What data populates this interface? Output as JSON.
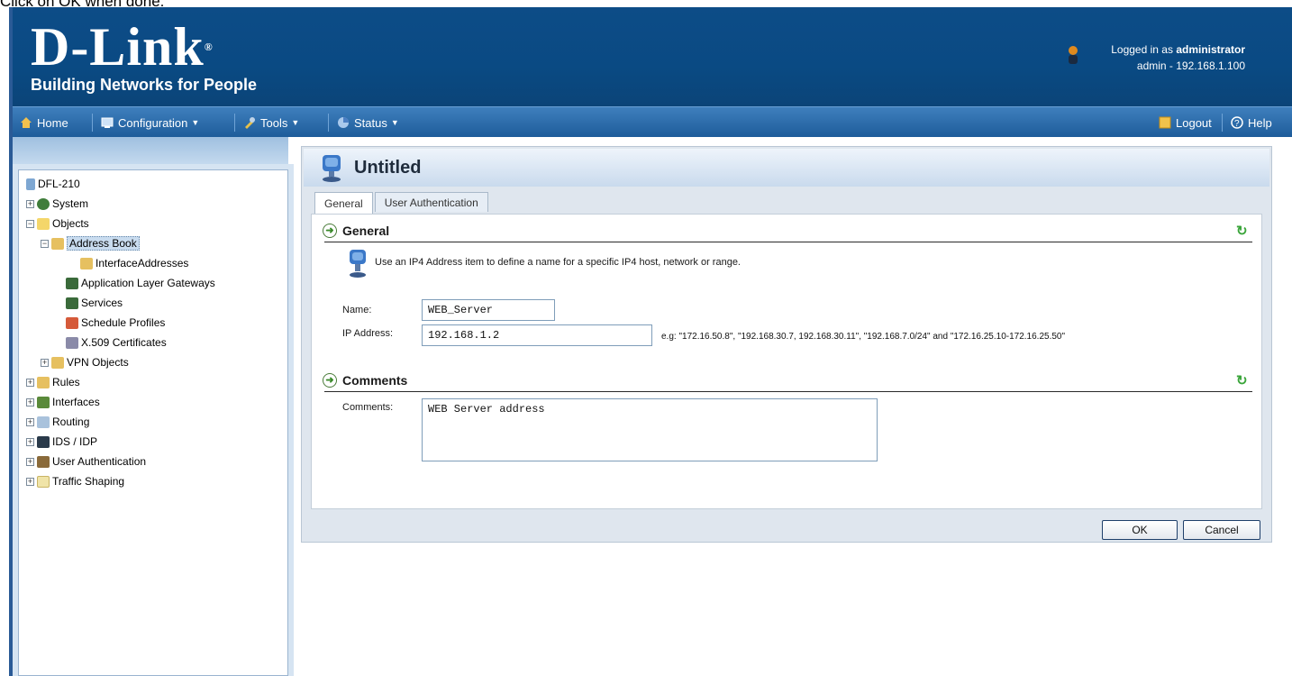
{
  "caption": "Click on OK when done.",
  "header": {
    "logo_text": "D-Link",
    "logo_tagline": "Building Networks for People",
    "logged_in_prefix": "Logged in as",
    "user": "administrator",
    "session": "admin - 192.168.1.100"
  },
  "menu": {
    "home": "Home",
    "configuration": "Configuration",
    "tools": "Tools",
    "status": "Status",
    "logout": "Logout",
    "help": "Help"
  },
  "tree": [
    {
      "label": "DFL-210"
    },
    {
      "label": "System"
    },
    {
      "label": "Objects"
    },
    {
      "label": "Address Book"
    },
    {
      "label": "InterfaceAddresses"
    },
    {
      "label": "Application Layer Gateways"
    },
    {
      "label": "Services"
    },
    {
      "label": "Schedule Profiles"
    },
    {
      "label": "X.509 Certificates"
    },
    {
      "label": "VPN Objects"
    },
    {
      "label": "Rules"
    },
    {
      "label": "Interfaces"
    },
    {
      "label": "Routing"
    },
    {
      "label": "IDS / IDP"
    },
    {
      "label": "User Authentication"
    },
    {
      "label": "Traffic Shaping"
    }
  ],
  "panel": {
    "title": "Untitled",
    "tabs": [
      {
        "label": "General"
      },
      {
        "label": "User Authentication"
      }
    ],
    "general_title": "General",
    "description": "Use an IP4 Address item to define a name for a specific IP4 host, network or range.",
    "name_label": "Name:",
    "name_value": "WEB_Server",
    "ip_label": "IP Address:",
    "ip_value": "192.168.1.2",
    "ip_hint": "e.g: \"172.16.50.8\", \"192.168.30.7, 192.168.30.11\", \"192.168.7.0/24\" and \"172.16.25.10-172.16.25.50\"",
    "comments_title": "Comments",
    "comments_label": "Comments:",
    "comments_value": "WEB Server address",
    "ok_label": "OK",
    "cancel_label": "Cancel"
  },
  "colors": {
    "header_blue": "#0a4a83",
    "menubar_blue": "#2b6aa8",
    "panel_bg": "#dfe6ee",
    "refresh_green": "#3aa53a"
  }
}
